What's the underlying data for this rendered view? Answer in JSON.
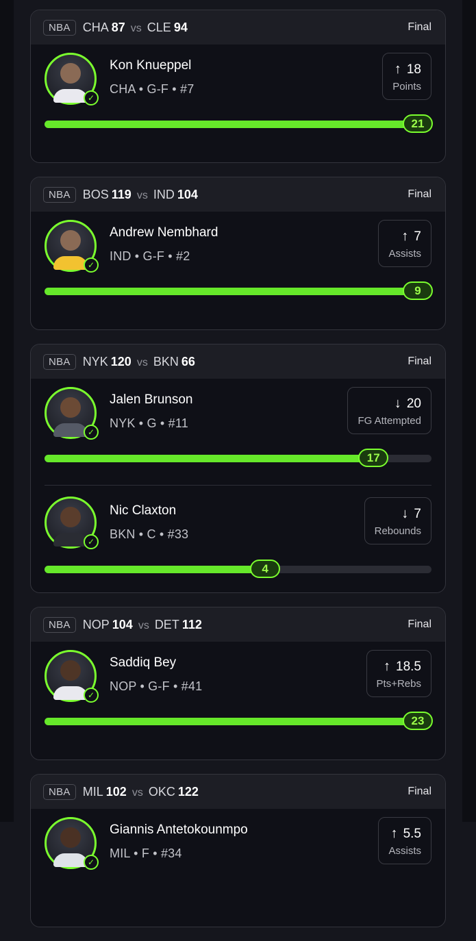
{
  "cards": [
    {
      "league": "NBA",
      "team1": "CHA",
      "score1": "87",
      "vs": "vs",
      "team2": "CLE",
      "score2": "94",
      "status": "Final",
      "players": [
        {
          "name": "Kon Knueppel",
          "meta": "CHA • G-F • #7",
          "direction": "up",
          "arrow": "↑",
          "line": "18",
          "stat": "Points",
          "result": "21",
          "progress": 1.0
        }
      ]
    },
    {
      "league": "NBA",
      "team1": "BOS",
      "score1": "119",
      "vs": "vs",
      "team2": "IND",
      "score2": "104",
      "status": "Final",
      "players": [
        {
          "name": "Andrew Nembhard",
          "meta": "IND • G-F • #2",
          "direction": "up",
          "arrow": "↑",
          "line": "7",
          "stat": "Assists",
          "result": "9",
          "progress": 1.0
        }
      ]
    },
    {
      "league": "NBA",
      "team1": "NYK",
      "score1": "120",
      "vs": "vs",
      "team2": "BKN",
      "score2": "66",
      "status": "Final",
      "players": [
        {
          "name": "Jalen Brunson",
          "meta": "NYK • G • #11",
          "direction": "down",
          "arrow": "↓",
          "line": "20",
          "stat": "FG Attempted",
          "result": "17",
          "progress": 0.85
        },
        {
          "name": "Nic Claxton",
          "meta": "BKN • C • #33",
          "direction": "down",
          "arrow": "↓",
          "line": "7",
          "stat": "Rebounds",
          "result": "4",
          "progress": 0.57
        }
      ]
    },
    {
      "league": "NBA",
      "team1": "NOP",
      "score1": "104",
      "vs": "vs",
      "team2": "DET",
      "score2": "112",
      "status": "Final",
      "players": [
        {
          "name": "Saddiq Bey",
          "meta": "NOP • G-F • #41",
          "direction": "up",
          "arrow": "↑",
          "line": "18.5",
          "stat": "Pts+Rebs",
          "result": "23",
          "progress": 1.0
        }
      ]
    },
    {
      "league": "NBA",
      "team1": "MIL",
      "score1": "102",
      "vs": "vs",
      "team2": "OKC",
      "score2": "122",
      "status": "Final",
      "players": [
        {
          "name": "Giannis Antetokounmpo",
          "meta": "MIL • F • #34",
          "direction": "up",
          "arrow": "↑",
          "line": "5.5",
          "stat": "Assists",
          "result": "",
          "progress": 0
        }
      ]
    }
  ],
  "colors": {
    "accent": "#7bff2e",
    "fill": "#66e82a",
    "card_bg": "#0f1017",
    "header_bg": "#1d1e25",
    "page_bg": "#15161d"
  },
  "icons": {
    "check": "✓",
    "up": "arrow-up-icon",
    "down": "arrow-down-icon"
  }
}
